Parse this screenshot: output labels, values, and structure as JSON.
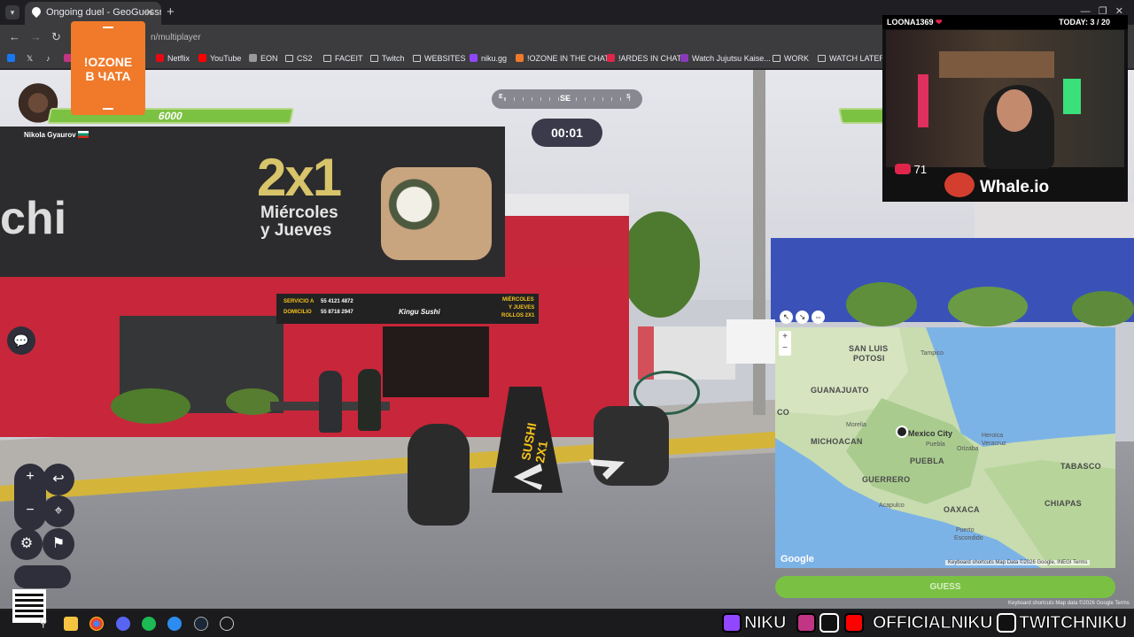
{
  "browser": {
    "tab_title": "Ongoing duel - GeoGuessr",
    "url": "n/multiplayer",
    "bookmarks": [
      "Netflix",
      "YouTube",
      "EON",
      "CS2",
      "FACEIT",
      "Twitch",
      "WEBSITES",
      "niku.gg",
      "!OZONE IN THE CHAT",
      "!ARDES IN CHAT",
      "Watch Jujutsu Kaise...",
      "WORK",
      "WATCH LATER"
    ]
  },
  "game": {
    "compass": {
      "heading": "SE",
      "left": "E",
      "right": "S"
    },
    "timer": "00:01",
    "player": {
      "name": "Nikola Gyaurov",
      "hp": "6000"
    }
  },
  "overlay": {
    "ozone_line1": "!OZONE",
    "ozone_line2": "В ЧАТА"
  },
  "scene": {
    "promo_big": "2x1",
    "promo_line1": "Miércoles",
    "promo_line2": "y Jueves",
    "storefront_text": "chi",
    "sign_left1": "SERVICIO A",
    "sign_left2": "DOMICILIO",
    "sign_phone1": "55 4121 4872",
    "sign_phone2": "55 8718 2947",
    "sign_logo": "Kingu Sushi",
    "sign_right1": "MIÉRCOLES",
    "sign_right2": "Y JUEVES",
    "sign_right3": "ROLLOS 2X1",
    "aframe_text": "SUSHI 2X1"
  },
  "map": {
    "labels": {
      "san_luis": "SAN LUIS",
      "potosi": "POTOSI",
      "tampico": "Tampico",
      "guanajuato": "GUANAJUATO",
      "co": "CO",
      "morelia": "Morelia",
      "mexico_city": "Mexico City",
      "puebla_city": "Puebla",
      "heroica": "Heroica",
      "veracruz": "Veracruz",
      "michoacan": "MICHOACAN",
      "orizaba": "Orizaba",
      "puebla": "PUEBLA",
      "tabasco": "TABASCO",
      "guerrero": "GUERRERO",
      "acapulco": "Acapulco",
      "oaxaca": "OAXACA",
      "chiapas": "CHIAPAS",
      "puerto": "Puerto",
      "escondido": "Escondido"
    },
    "google": "Google",
    "attribution": "Keyboard shortcuts   Map Data ©2026 Google, INEGI   Terms",
    "guess_label": "GUESS",
    "footer": "Keyboard shortcuts   Map data ©2026 Google   Terms"
  },
  "webcam": {
    "username": "LOONA1369",
    "today": "TODAY: 3 / 20",
    "heart_rate": "71",
    "sponsor": "Whale.io"
  },
  "socials": {
    "twitch": "NIKU",
    "handle": "OFFICIALNIKU",
    "tiktok": "TWITCHNIKU"
  },
  "colors": {
    "accent_green": "#7cc242",
    "ozone_orange": "#f07a2a",
    "sign_red": "#c8263a"
  }
}
